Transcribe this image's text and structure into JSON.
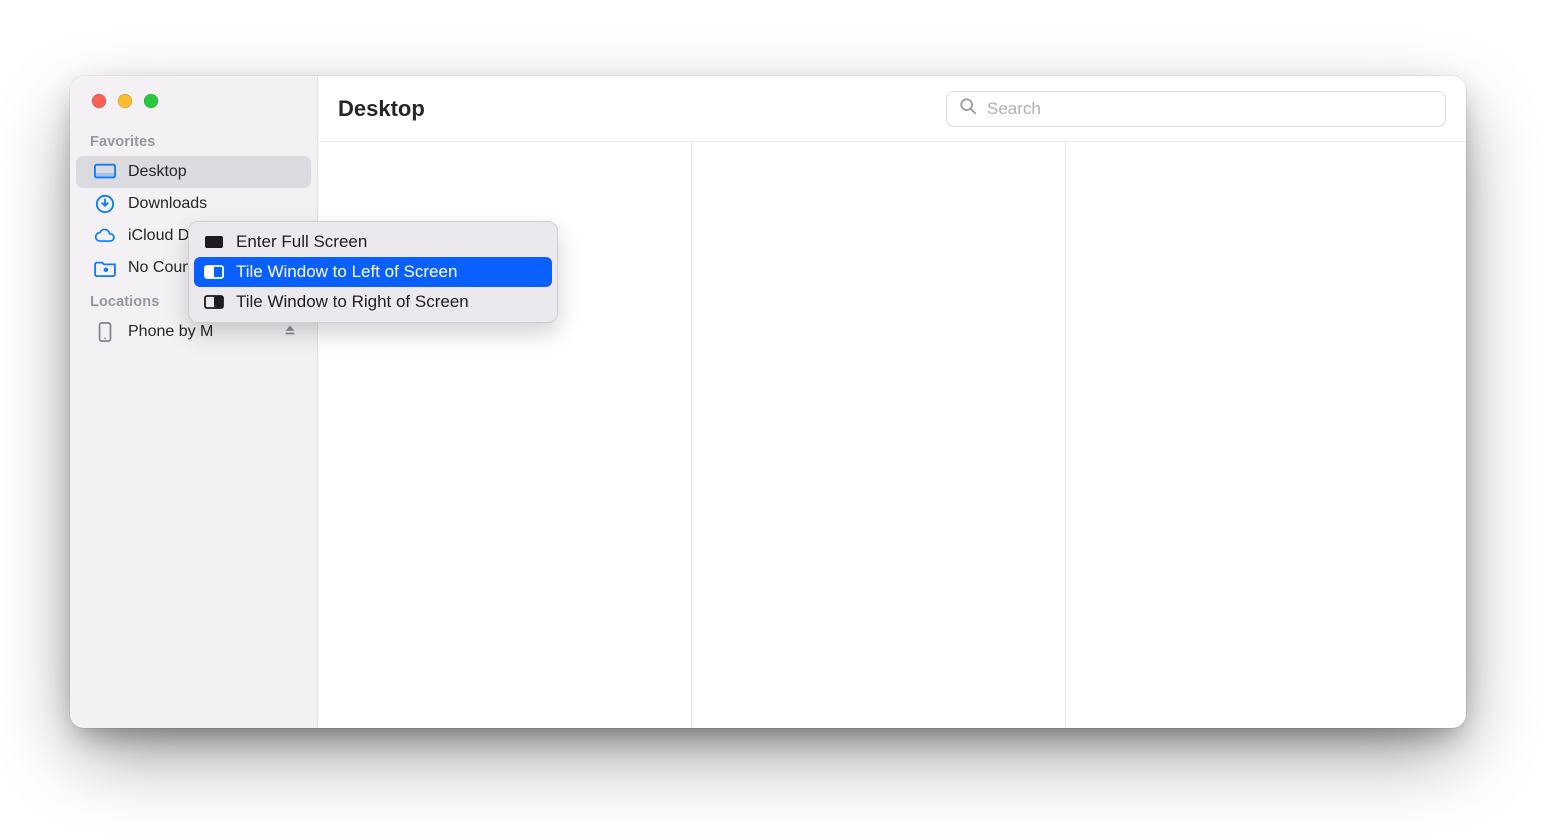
{
  "toolbar": {
    "title": "Desktop",
    "search_placeholder": "Search"
  },
  "sidebar": {
    "sections": {
      "favorites_title": "Favorites",
      "locations_title": "Locations"
    },
    "items": [
      {
        "label": "Desktop",
        "icon": "desktop-icon",
        "selected": true
      },
      {
        "label": "Downloads",
        "icon": "download-icon"
      },
      {
        "label": "iCloud Drive",
        "icon": "cloud-icon"
      },
      {
        "label": "No Country Studio",
        "icon": "camera-folder-icon"
      }
    ],
    "locations": [
      {
        "label": "Phone by M",
        "icon": "phone-icon",
        "ejectable": true
      }
    ]
  },
  "windowMenu": {
    "items": [
      {
        "label": "Enter Full Screen",
        "icon": "fullscreen-rect-icon"
      },
      {
        "label": "Tile Window to Left of Screen",
        "icon": "tile-left-icon",
        "hover": true
      },
      {
        "label": "Tile Window to Right of Screen",
        "icon": "tile-right-icon"
      }
    ]
  }
}
